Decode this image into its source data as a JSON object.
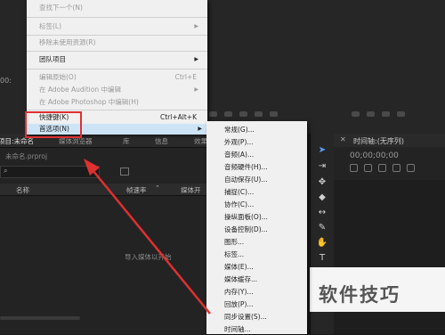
{
  "source_monitor": {
    "timecode": "00:"
  },
  "main_menu": {
    "items": [
      {
        "label": "查找下一个(N)",
        "enabled": false
      },
      {
        "label": "标签(L)",
        "enabled": false,
        "arrow": "▶"
      },
      {
        "label": "移除未使用资源(R)",
        "enabled": false
      },
      {
        "label": "团队项目",
        "enabled": true,
        "arrow": "▶"
      },
      {
        "label": "编辑原始(O)",
        "enabled": false,
        "shortcut": "Ctrl+E"
      },
      {
        "label": "在 Adobe Audition 中编辑",
        "enabled": false,
        "arrow": "▶"
      },
      {
        "label": "在 Adobe Photoshop 中编辑(H)",
        "enabled": false
      },
      {
        "label": "快捷键(K)",
        "enabled": true,
        "shortcut": "Ctrl+Alt+K"
      },
      {
        "label": "首选项(N)",
        "enabled": true,
        "arrow": "▶"
      }
    ]
  },
  "preferences_submenu": {
    "items": [
      "常规(G)...",
      "外观(P)...",
      "音频(A)...",
      "音频硬件(H)...",
      "自动保存(U)...",
      "捕捉(C)...",
      "协作(C)...",
      "操纵面板(O)...",
      "设备控制(D)...",
      "图形...",
      "标签...",
      "媒体(E)...",
      "媒体缓存...",
      "内存(Y)...",
      "回放(P)...",
      "同步设置(S)...",
      "时间轴..."
    ]
  },
  "project_panel": {
    "tabs": [
      "项目:未命名",
      "媒体浏览器",
      "库",
      "信息",
      "效果"
    ],
    "file_name": "未命名.prproj",
    "columns": [
      "名称",
      "帧速率",
      "媒体开"
    ],
    "empty_message": "导入媒体以开始"
  },
  "timeline_panel": {
    "title": "时间轴:(无序列)",
    "timecode": "00;00;00;00"
  },
  "watermark": "软件技巧",
  "colors": {
    "highlight": "#cde4f7",
    "annotation": "#e03030",
    "menu_bg": "#f0f0f0"
  }
}
